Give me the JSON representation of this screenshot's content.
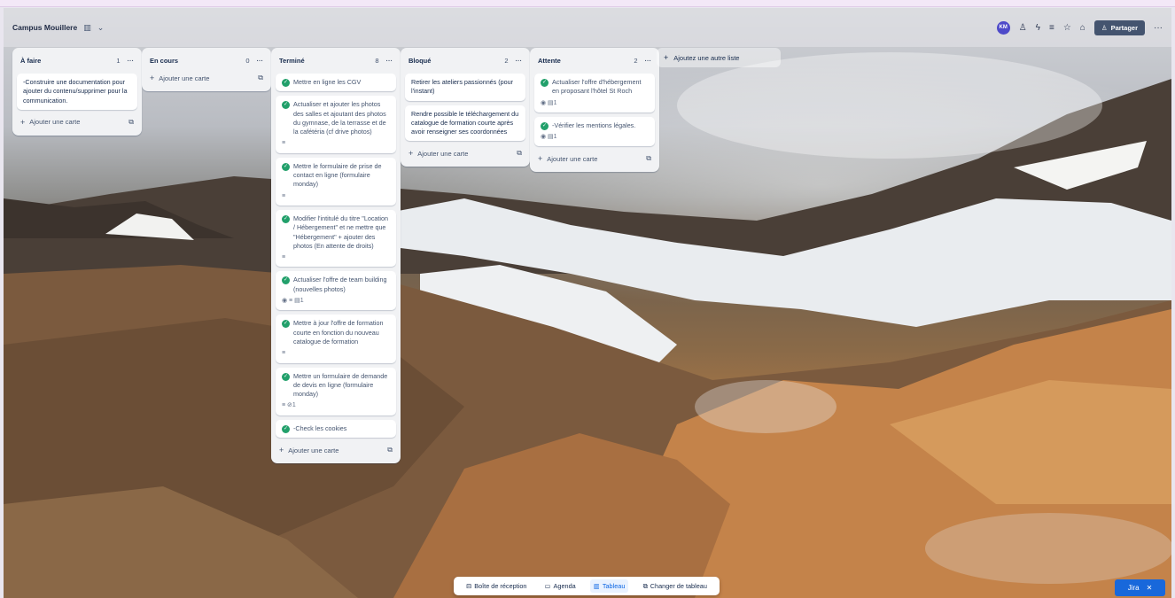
{
  "board": {
    "title": "Campus Mouillere",
    "avatar_initials": "KM",
    "share_label": "Partager",
    "header_icons": [
      "board-switch-icon",
      "chevron-down-icon",
      "power-up-icon",
      "automation-icon",
      "filter-icon",
      "star-icon",
      "lock-icon",
      "person-add-icon",
      "more-icon"
    ]
  },
  "lists": [
    {
      "title": "À faire",
      "count": "1",
      "cards": [
        {
          "text": "-Construire une documentation pour ajouter du contenu/supprimer pour la communication.",
          "done": false
        }
      ],
      "add_label": "Ajouter une carte"
    },
    {
      "title": "En cours",
      "count": "0",
      "cards": [],
      "add_label": "Ajouter une carte"
    },
    {
      "title": "Terminé",
      "count": "8",
      "cards": [
        {
          "text": "Mettre en ligne les CGV",
          "done": true
        },
        {
          "text": "Actualiser et ajouter les photos des salles et ajoutant des photos du gymnase, de la terrasse et de la cafétéria (cf drive photos)",
          "done": true,
          "badges": "≡"
        },
        {
          "text": "Mettre le formulaire de prise de contact en ligne (formulaire monday)",
          "done": true,
          "badges": "≡"
        },
        {
          "text": "Modifier l'intitulé du titre \"Location / Hébergement\" et ne mettre que \"Hébergement\" + ajouter des photos (En attente de droits)",
          "done": true,
          "badges": "≡"
        },
        {
          "text": "Actualiser l'offre de team building (nouvelles photos)",
          "done": true,
          "badges": "◉   ≡   ▤1"
        },
        {
          "text": "Mettre à jour l'offre de formation courte en fonction du nouveau catalogue de formation",
          "done": true,
          "badges": "≡"
        },
        {
          "text": "Mettre un formulaire de demande de devis en ligne (formulaire monday)",
          "done": true,
          "badges": "≡   ⊘1"
        },
        {
          "text": "-Check les cookies",
          "done": true
        }
      ],
      "add_label": "Ajouter une carte"
    },
    {
      "title": "Bloqué",
      "count": "2",
      "cards": [
        {
          "text": "Retirer les ateliers passionnés (pour l'instant)",
          "done": false
        },
        {
          "text": "Rendre possible le téléchargement du catalogue de formation courte après avoir renseigner ses coordonnées",
          "done": false
        }
      ],
      "add_label": "Ajouter une carte"
    },
    {
      "title": "Attente",
      "count": "2",
      "cards": [
        {
          "text": "Actualiser l'offre d'hébergement en proposant l'hôtel St Roch",
          "done": true,
          "badges": "◉   ▤1"
        },
        {
          "text": "-Vérifier les mentions légales.",
          "done": true,
          "badges": "◉   ▤1"
        }
      ],
      "add_label": "Ajouter une carte"
    }
  ],
  "add_list_label": "Ajoutez une autre liste",
  "bottom_nav": {
    "inbox": "Boîte de réception",
    "planner": "Agenda",
    "board": "Tableau",
    "switch": "Changer de tableau"
  },
  "jira_label": "Jira"
}
